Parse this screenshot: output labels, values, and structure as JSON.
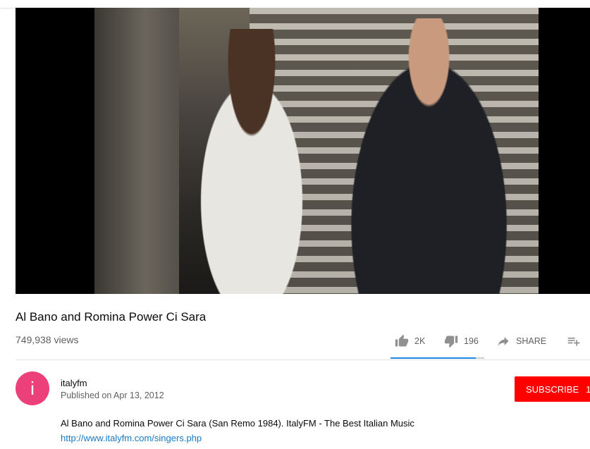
{
  "video": {
    "title": "Al Bano and Romina Power Ci Sara",
    "views": "749,938 views"
  },
  "actions": {
    "likes": "2K",
    "dislikes": "196",
    "share_label": "SHARE",
    "like_ratio": 0.91
  },
  "channel": {
    "avatar_letter": "i",
    "name": "italyfm",
    "published": "Published on Apr 13, 2012",
    "subscribe_label": "SUBSCRIBE",
    "subscriber_count": "1"
  },
  "description": {
    "text": "Al Bano and Romina Power Ci Sara (San Remo 1984). ItalyFM - The Best Italian Music",
    "link": "http://www.italyfm.com/singers.php"
  },
  "colors": {
    "avatar": "#ec407a",
    "subscribe": "#ff0000",
    "link": "#167ac6",
    "sentiment_fill": "#1e88e5"
  }
}
